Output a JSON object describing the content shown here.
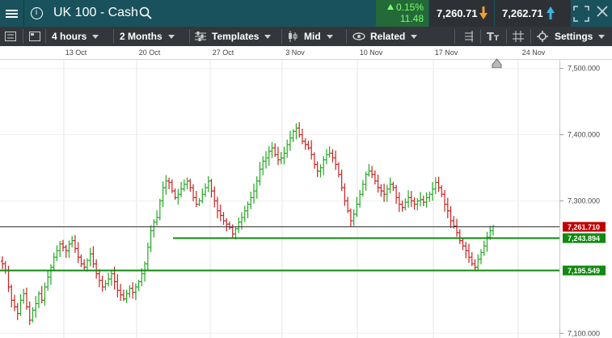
{
  "toolbar_top": {
    "instrument": "UK 100 - Cash",
    "change_percent": "0.15%",
    "change_points": "11.48",
    "sell_price": "7,260.71",
    "buy_price": "7,262.71",
    "colors": {
      "header_bg": "#19525c",
      "positive": "#7cff69",
      "sell_arrow": "#f0a030",
      "buy_arrow": "#3db5e6"
    }
  },
  "toolbar": {
    "interval": "4 hours",
    "range": "2 Months",
    "templates": "Templates",
    "price_type": "Mid",
    "related": "Related",
    "settings": "Settings"
  },
  "chart_data": {
    "type": "ohlc",
    "x_ticks": [
      "13 Oct",
      "20 Oct",
      "27 Oct",
      "3 Nov",
      "10 Nov",
      "17 Nov",
      "24 Nov"
    ],
    "y_ticks": [
      "7,500.000",
      "7,400.000",
      "7,300.000",
      "7,100.000"
    ],
    "ylim": [
      7093,
      7513
    ],
    "horizontal_lines": [
      {
        "value": 7261.71,
        "label": "7,261.710",
        "color": "#c00000",
        "line_color": "#333333"
      },
      {
        "value": 7243.894,
        "label": "7,243.894",
        "color": "#0f8a0f",
        "line_color": "#0f8a0f"
      },
      {
        "value": 7195.549,
        "label": "7,195.549",
        "color": "#0f8a0f",
        "line_color": "#0f8a0f"
      }
    ],
    "bar_colors": {
      "up": "#22aa22",
      "down": "#cc2222"
    },
    "closes": [
      7205,
      7195,
      7170,
      7150,
      7140,
      7130,
      7150,
      7160,
      7140,
      7120,
      7135,
      7145,
      7160,
      7150,
      7170,
      7185,
      7200,
      7215,
      7225,
      7235,
      7230,
      7225,
      7235,
      7240,
      7228,
      7215,
      7205,
      7200,
      7210,
      7220,
      7205,
      7190,
      7180,
      7170,
      7175,
      7182,
      7190,
      7178,
      7165,
      7158,
      7152,
      7160,
      7168,
      7162,
      7170,
      7178,
      7190,
      7205,
      7230,
      7255,
      7268,
      7275,
      7300,
      7320,
      7330,
      7328,
      7315,
      7305,
      7310,
      7318,
      7325,
      7330,
      7320,
      7305,
      7295,
      7300,
      7310,
      7320,
      7330,
      7315,
      7300,
      7285,
      7278,
      7270,
      7265,
      7260,
      7250,
      7258,
      7268,
      7275,
      7285,
      7295,
      7305,
      7315,
      7330,
      7348,
      7360,
      7365,
      7375,
      7380,
      7370,
      7362,
      7365,
      7372,
      7385,
      7395,
      7405,
      7410,
      7400,
      7390,
      7385,
      7380,
      7370,
      7355,
      7345,
      7350,
      7362,
      7370,
      7372,
      7365,
      7355,
      7340,
      7320,
      7300,
      7285,
      7270,
      7280,
      7295,
      7310,
      7325,
      7340,
      7345,
      7340,
      7330,
      7320,
      7315,
      7310,
      7318,
      7325,
      7320,
      7305,
      7295,
      7290,
      7298,
      7305,
      7300,
      7295,
      7300,
      7302,
      7298,
      7305,
      7310,
      7318,
      7328,
      7320,
      7310,
      7295,
      7285,
      7270,
      7262,
      7252,
      7240,
      7232,
      7225,
      7215,
      7205,
      7200,
      7212,
      7222,
      7232,
      7245,
      7255,
      7261
    ]
  }
}
